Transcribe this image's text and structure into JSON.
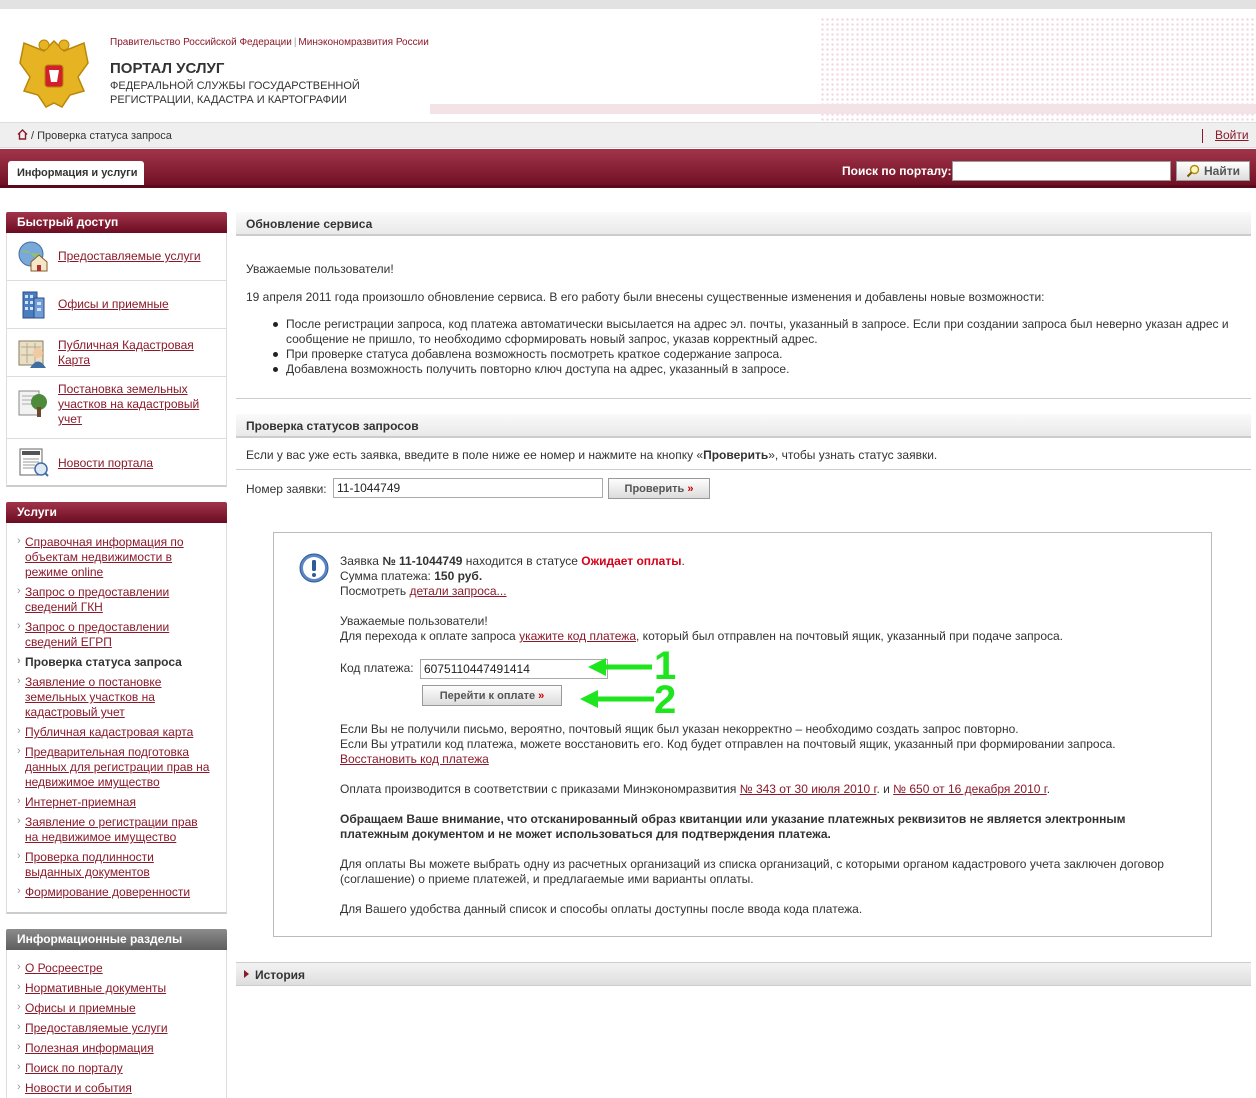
{
  "header": {
    "gov_link_1": "Правительство Российской Федерации",
    "gov_sep": "|",
    "gov_link_2": "Минэкономразвития России",
    "title": "ПОРТАЛ УСЛУГ",
    "subtitle": "ФЕДЕРАЛЬНОЙ СЛУЖБЫ ГОСУДАРСТВЕННОЙ РЕГИСТРАЦИИ, КАДАСТРА И КАРТОГРАФИИ"
  },
  "breadcrumb": {
    "text": "/ Проверка статуса запроса",
    "login": "Войти"
  },
  "nav": {
    "tab": "Информация и услуги",
    "search_label": "Поиск по порталу:",
    "search_value": "",
    "search_button": "Найти"
  },
  "sidebar": {
    "quick_access_title": "Быстрый доступ",
    "quick_access": [
      {
        "label": "Предоставляемые услуги",
        "icon": "globe-house-icon"
      },
      {
        "label": "Офисы и приемные",
        "icon": "building-icon"
      },
      {
        "label": "Публичная Кадастровая Карта",
        "icon": "map-person-icon"
      },
      {
        "label": "Постановка земельных участков на кадастровый учет",
        "icon": "land-tree-icon"
      },
      {
        "label": "Новости портала",
        "icon": "newspaper-icon"
      }
    ],
    "services_title": "Услуги",
    "services": [
      "Справочная информация по объектам недвижимости в режиме online",
      "Запрос о предоставлении сведений ГКН",
      "Запрос о предоставлении сведений ЕГРП",
      "Проверка статуса запроса",
      "Заявление о постановке земельных участков на кадастровый учет",
      "Публичная кадастровая карта",
      "Предварительная подготовка данных для регистрации прав на недвижимое имущество",
      "Интернет-приемная",
      "Заявление о регистрации прав на недвижимое имущество",
      "Проверка подлинности выданных документов",
      "Формирование доверенности"
    ],
    "info_title": "Информационные разделы",
    "info": [
      "О Росреестре",
      "Нормативные документы",
      "Офисы и приемные",
      "Предоставляемые услуги",
      "Полезная информация",
      "Поиск по порталу",
      "Новости и события"
    ]
  },
  "update": {
    "title": "Обновление сервиса",
    "greeting": "Уважаемые пользователи!",
    "intro": "19 апреля 2011 года  произошло обновление сервиса. В его работу были внесены существенные изменения и добавлены новые возможности:",
    "bullets": [
      "После регистрации запроса, код платежа автоматически высылается на адрес эл. почты, указанный в запросе. Если при создании запроса был неверно указан адрес и сообщение не пришло, то необходимо сформировать новый запрос, указав корректный адрес.",
      "При проверке статуса добавлена возможность посмотреть краткое содержание запроса.",
      "Добавлена возможность получить повторно ключ доступа на адрес, указанный в запросе."
    ]
  },
  "check": {
    "title": "Проверка статусов запросов",
    "hint_1": "Если у вас уже есть заявка, введите в поле ниже ее номер и нажмите на кнопку «",
    "hint_bold": "Проверить",
    "hint_2": "», чтобы узнать статус заявки.",
    "number_label": "Номер заявки:",
    "number_value": "11-1044749",
    "button": "Проверить"
  },
  "result": {
    "l1_a": "Заявка ",
    "l1_num": "№ 11-1044749",
    "l1_b": " находится в статусе ",
    "l1_status": "Ожидает оплаты",
    "l1_c": ".",
    "l2_a": "Сумма платежа: ",
    "l2_sum": "150 руб.",
    "l3_a": "Посмотреть ",
    "l3_link": "детали запроса...",
    "greeting": "Уважаемые пользователи!",
    "pay_a": "Для перехода к оплате запроса ",
    "pay_link": "укажите код платежа",
    "pay_b": ", который был отправлен на почтовый ящик, указанный при подаче запроса.",
    "code_label": "Код платежа:",
    "code_value": "6075110447491414",
    "pay_button": "Перейти к оплате",
    "annotation_1": "1",
    "annotation_2": "2",
    "no_letter": "Если Вы не получили письмо, вероятно, почтовый ящик был указан некорректно – необходимо создать запрос повторно.",
    "lost_code": "Если Вы утратили код платежа, можете восстановить его. Код будет отправлен на почтовый ящик, указанный при формировании запроса.",
    "restore_link": "Восстановить код платежа",
    "orders_a": "Оплата производится в соответствии с приказами Минэкономразвития ",
    "order_1": "№ 343 от 30 июля 2010 г",
    "orders_b": ". и ",
    "order_2": "№ 650 от 16 декабря 2010 г",
    "orders_c": ".",
    "warning": "Обращаем Ваше внимание, что отсканированный образ квитанции или указание платежных реквизитов не является электронным платежным документом и не может использоваться для подтверждения платежа.",
    "orgs": "Для оплаты Вы можете выбрать одну из расчетных организаций из списка организаций, с которыми органом кадастрового учета заключен договор (соглашение) о приеме платежей, и предлагаемые ими варианты оплаты.",
    "convenience": "Для Вашего удобства данный список и способы оплаты доступны после ввода кода платежа."
  },
  "history": {
    "title": "История"
  },
  "colors": {
    "brand": "#8a1a2a",
    "status_red": "#d4001a",
    "annotation_green": "#1ee51e"
  }
}
